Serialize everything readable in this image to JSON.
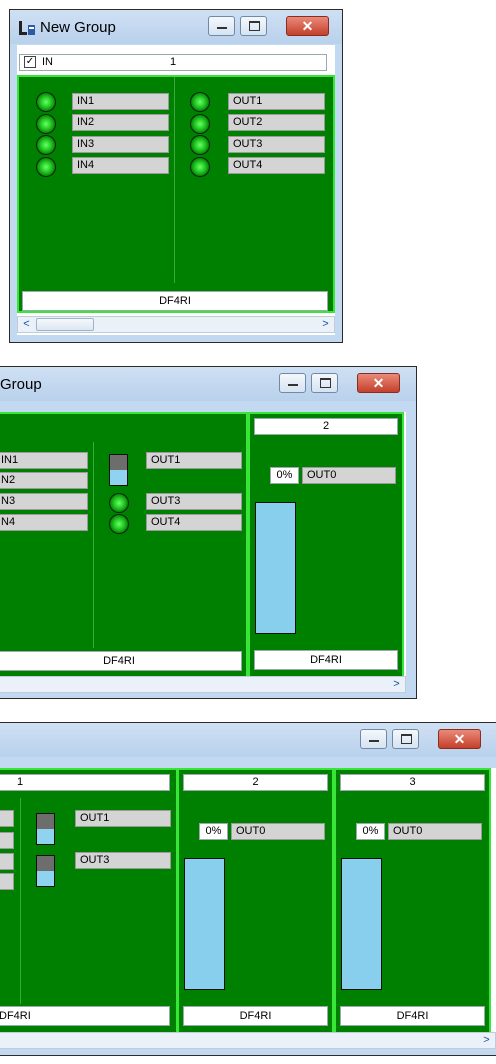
{
  "window1": {
    "title": "New Group",
    "header_label": "IN",
    "group_number": "1",
    "inputs": [
      "IN1",
      "IN2",
      "IN3",
      "IN4"
    ],
    "outputs": [
      "OUT1",
      "OUT2",
      "OUT3",
      "OUT4"
    ],
    "footer": "DF4RI",
    "checkbox_checked": true
  },
  "window2": {
    "title": "Group",
    "group1": {
      "number": "1",
      "footer": "DF4RI",
      "inputs": [
        "IN1",
        "N2",
        "N3",
        "N4"
      ],
      "outputs": [
        "OUT1",
        "OUT3",
        "OUT4"
      ]
    },
    "group2": {
      "number": "2",
      "percent": "0%",
      "output": "OUT0",
      "footer": "DF4RI",
      "level": 0
    }
  },
  "window3": {
    "group1": {
      "number": "1",
      "footer": "DF4RI",
      "outputs": [
        "OUT1",
        "OUT3"
      ]
    },
    "group2": {
      "number": "2",
      "percent": "0%",
      "output": "OUT0",
      "footer": "DF4RI",
      "level": 0
    },
    "group3": {
      "number": "3",
      "percent": "0%",
      "output": "OUT0",
      "footer": "DF4RI",
      "level": 0
    }
  },
  "icons": {
    "minimize": "minimize-icon",
    "maximize": "maximize-icon",
    "close": "close-icon",
    "scroll_left": "chevron-left-icon",
    "scroll_right": "chevron-right-icon"
  },
  "colors": {
    "panel_green": "#008000",
    "panel_border": "#37e637",
    "led_green": "#1fc81f",
    "level_blue": "#88cfee"
  }
}
